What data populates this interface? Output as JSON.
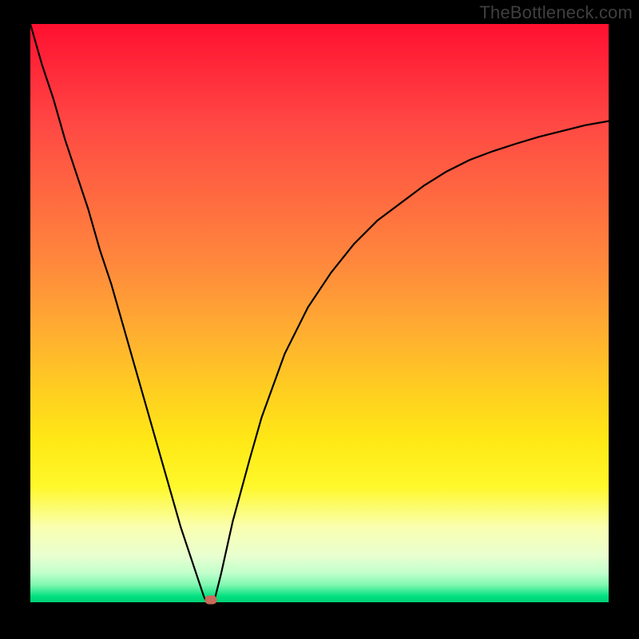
{
  "watermark_text": "TheBottleneck.com",
  "chart_data": {
    "type": "line",
    "title": "",
    "xlabel": "",
    "ylabel": "",
    "x": [
      0.0,
      0.02,
      0.04,
      0.06,
      0.08,
      0.1,
      0.12,
      0.14,
      0.16,
      0.18,
      0.2,
      0.22,
      0.24,
      0.26,
      0.28,
      0.3,
      0.305,
      0.31,
      0.315,
      0.32,
      0.33,
      0.35,
      0.38,
      0.4,
      0.44,
      0.48,
      0.52,
      0.56,
      0.6,
      0.64,
      0.68,
      0.72,
      0.76,
      0.8,
      0.84,
      0.88,
      0.92,
      0.96,
      1.0
    ],
    "y": [
      1.0,
      0.93,
      0.87,
      0.8,
      0.74,
      0.68,
      0.61,
      0.55,
      0.48,
      0.41,
      0.34,
      0.27,
      0.2,
      0.13,
      0.07,
      0.01,
      0.0,
      0.0,
      0.002,
      0.01,
      0.05,
      0.14,
      0.25,
      0.32,
      0.43,
      0.51,
      0.57,
      0.62,
      0.66,
      0.69,
      0.72,
      0.745,
      0.765,
      0.78,
      0.793,
      0.805,
      0.815,
      0.825,
      0.832
    ],
    "xlim": [
      0,
      1
    ],
    "ylim": [
      0,
      1
    ],
    "dip_marker": {
      "x": 0.312,
      "y": 0.004
    },
    "background_gradient": {
      "direction": "vertical",
      "stops": [
        {
          "pos": 0.0,
          "color": "#ff1030"
        },
        {
          "pos": 0.5,
          "color": "#ffb030"
        },
        {
          "pos": 0.8,
          "color": "#fff82a"
        },
        {
          "pos": 0.95,
          "color": "#c0ffcc"
        },
        {
          "pos": 1.0,
          "color": "#00d074"
        }
      ]
    }
  }
}
